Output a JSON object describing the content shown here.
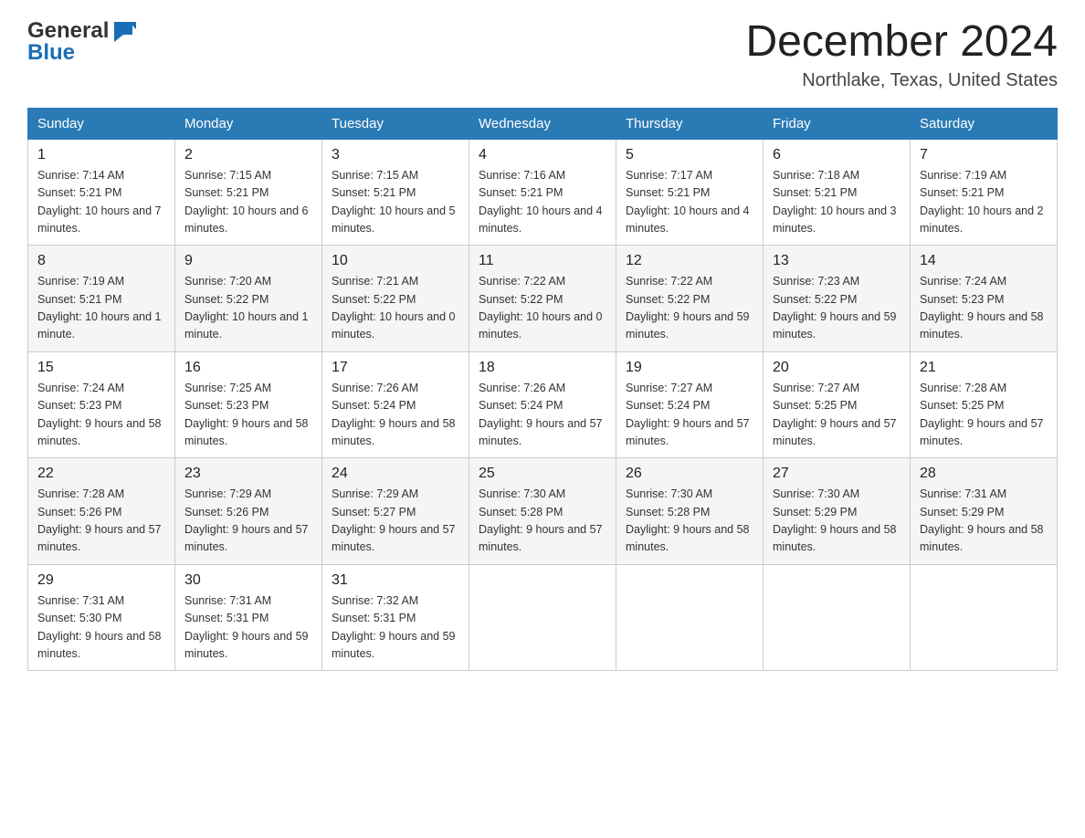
{
  "header": {
    "logo": {
      "general": "General",
      "blue": "Blue"
    },
    "title": "December 2024",
    "location": "Northlake, Texas, United States"
  },
  "days_of_week": [
    "Sunday",
    "Monday",
    "Tuesday",
    "Wednesday",
    "Thursday",
    "Friday",
    "Saturday"
  ],
  "weeks": [
    [
      {
        "day": "1",
        "sunrise": "7:14 AM",
        "sunset": "5:21 PM",
        "daylight": "10 hours and 7 minutes."
      },
      {
        "day": "2",
        "sunrise": "7:15 AM",
        "sunset": "5:21 PM",
        "daylight": "10 hours and 6 minutes."
      },
      {
        "day": "3",
        "sunrise": "7:15 AM",
        "sunset": "5:21 PM",
        "daylight": "10 hours and 5 minutes."
      },
      {
        "day": "4",
        "sunrise": "7:16 AM",
        "sunset": "5:21 PM",
        "daylight": "10 hours and 4 minutes."
      },
      {
        "day": "5",
        "sunrise": "7:17 AM",
        "sunset": "5:21 PM",
        "daylight": "10 hours and 4 minutes."
      },
      {
        "day": "6",
        "sunrise": "7:18 AM",
        "sunset": "5:21 PM",
        "daylight": "10 hours and 3 minutes."
      },
      {
        "day": "7",
        "sunrise": "7:19 AM",
        "sunset": "5:21 PM",
        "daylight": "10 hours and 2 minutes."
      }
    ],
    [
      {
        "day": "8",
        "sunrise": "7:19 AM",
        "sunset": "5:21 PM",
        "daylight": "10 hours and 1 minute."
      },
      {
        "day": "9",
        "sunrise": "7:20 AM",
        "sunset": "5:22 PM",
        "daylight": "10 hours and 1 minute."
      },
      {
        "day": "10",
        "sunrise": "7:21 AM",
        "sunset": "5:22 PM",
        "daylight": "10 hours and 0 minutes."
      },
      {
        "day": "11",
        "sunrise": "7:22 AM",
        "sunset": "5:22 PM",
        "daylight": "10 hours and 0 minutes."
      },
      {
        "day": "12",
        "sunrise": "7:22 AM",
        "sunset": "5:22 PM",
        "daylight": "9 hours and 59 minutes."
      },
      {
        "day": "13",
        "sunrise": "7:23 AM",
        "sunset": "5:22 PM",
        "daylight": "9 hours and 59 minutes."
      },
      {
        "day": "14",
        "sunrise": "7:24 AM",
        "sunset": "5:23 PM",
        "daylight": "9 hours and 58 minutes."
      }
    ],
    [
      {
        "day": "15",
        "sunrise": "7:24 AM",
        "sunset": "5:23 PM",
        "daylight": "9 hours and 58 minutes."
      },
      {
        "day": "16",
        "sunrise": "7:25 AM",
        "sunset": "5:23 PM",
        "daylight": "9 hours and 58 minutes."
      },
      {
        "day": "17",
        "sunrise": "7:26 AM",
        "sunset": "5:24 PM",
        "daylight": "9 hours and 58 minutes."
      },
      {
        "day": "18",
        "sunrise": "7:26 AM",
        "sunset": "5:24 PM",
        "daylight": "9 hours and 57 minutes."
      },
      {
        "day": "19",
        "sunrise": "7:27 AM",
        "sunset": "5:24 PM",
        "daylight": "9 hours and 57 minutes."
      },
      {
        "day": "20",
        "sunrise": "7:27 AM",
        "sunset": "5:25 PM",
        "daylight": "9 hours and 57 minutes."
      },
      {
        "day": "21",
        "sunrise": "7:28 AM",
        "sunset": "5:25 PM",
        "daylight": "9 hours and 57 minutes."
      }
    ],
    [
      {
        "day": "22",
        "sunrise": "7:28 AM",
        "sunset": "5:26 PM",
        "daylight": "9 hours and 57 minutes."
      },
      {
        "day": "23",
        "sunrise": "7:29 AM",
        "sunset": "5:26 PM",
        "daylight": "9 hours and 57 minutes."
      },
      {
        "day": "24",
        "sunrise": "7:29 AM",
        "sunset": "5:27 PM",
        "daylight": "9 hours and 57 minutes."
      },
      {
        "day": "25",
        "sunrise": "7:30 AM",
        "sunset": "5:28 PM",
        "daylight": "9 hours and 57 minutes."
      },
      {
        "day": "26",
        "sunrise": "7:30 AM",
        "sunset": "5:28 PM",
        "daylight": "9 hours and 58 minutes."
      },
      {
        "day": "27",
        "sunrise": "7:30 AM",
        "sunset": "5:29 PM",
        "daylight": "9 hours and 58 minutes."
      },
      {
        "day": "28",
        "sunrise": "7:31 AM",
        "sunset": "5:29 PM",
        "daylight": "9 hours and 58 minutes."
      }
    ],
    [
      {
        "day": "29",
        "sunrise": "7:31 AM",
        "sunset": "5:30 PM",
        "daylight": "9 hours and 58 minutes."
      },
      {
        "day": "30",
        "sunrise": "7:31 AM",
        "sunset": "5:31 PM",
        "daylight": "9 hours and 59 minutes."
      },
      {
        "day": "31",
        "sunrise": "7:32 AM",
        "sunset": "5:31 PM",
        "daylight": "9 hours and 59 minutes."
      },
      null,
      null,
      null,
      null
    ]
  ]
}
